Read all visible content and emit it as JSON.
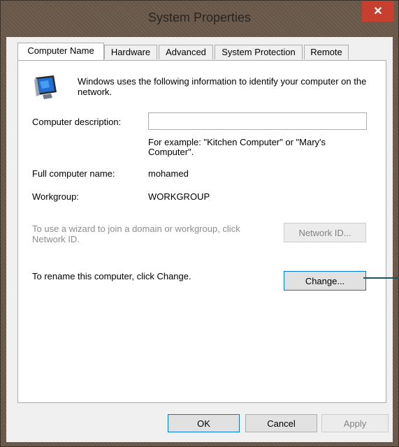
{
  "window": {
    "title": "System Properties",
    "close_glyph": "✕"
  },
  "tabs": [
    {
      "label": "Computer Name",
      "active": true
    },
    {
      "label": "Hardware",
      "active": false
    },
    {
      "label": "Advanced",
      "active": false
    },
    {
      "label": "System Protection",
      "active": false
    },
    {
      "label": "Remote",
      "active": false
    }
  ],
  "panel": {
    "icon": "computer-monitor-icon",
    "intro_text": "Windows uses the following information to identify your computer on the network.",
    "description_label": "Computer description:",
    "description_value": "",
    "example_text": "For example: \"Kitchen Computer\" or \"Mary's Computer\".",
    "full_name_label": "Full computer name:",
    "full_name_value": "mohamed",
    "workgroup_label": "Workgroup:",
    "workgroup_value": "WORKGROUP",
    "network_text": "To use a wizard to join a domain or workgroup, click Network ID.",
    "network_button": "Network ID...",
    "rename_text": "To rename this computer, click Change.",
    "change_button": "Change..."
  },
  "footer": {
    "ok": "OK",
    "cancel": "Cancel",
    "apply": "Apply"
  },
  "colors": {
    "close_button": "#c7402f",
    "focus_border": "#0078d7",
    "pointer_line": "#1d4f5e"
  }
}
